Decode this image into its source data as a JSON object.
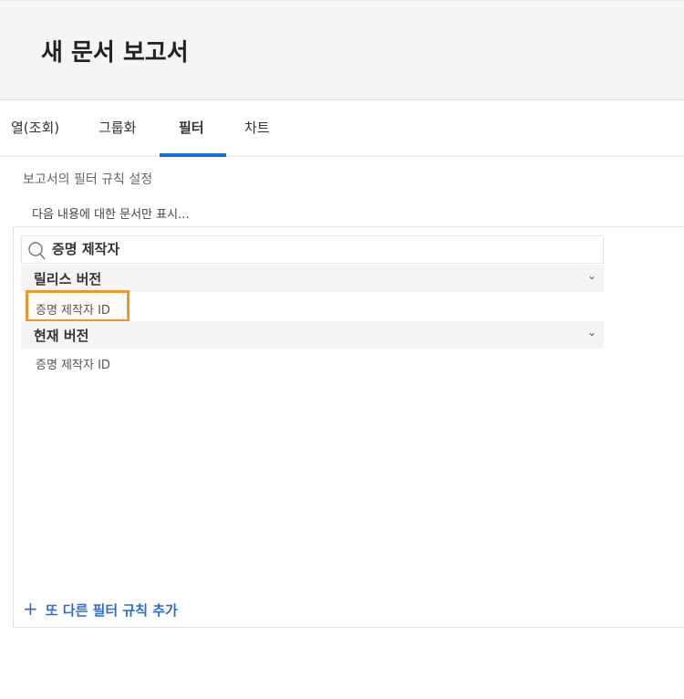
{
  "header": {
    "title": "새 문서 보고서"
  },
  "tabs": [
    {
      "label": "열(조회)"
    },
    {
      "label": "그룹화"
    },
    {
      "label": "필터",
      "active": true
    },
    {
      "label": "차트"
    }
  ],
  "filter": {
    "subtitle": "보고서의 필터 규칙 설정",
    "show_only": "다음 내용에 대한 문서만 표시...",
    "search_value": "증명 제작자",
    "groups": [
      {
        "label": "릴리스 버전",
        "items": [
          "증명 제작자 ID"
        ]
      },
      {
        "label": "현재 버전",
        "items": [
          "증명 제작자 ID"
        ]
      }
    ],
    "add_rule": "또 다른 필터 규칙 추가"
  },
  "colors": {
    "accent": "#1a6fd8",
    "highlight": "#f0952e",
    "link": "#2f6fc6"
  }
}
